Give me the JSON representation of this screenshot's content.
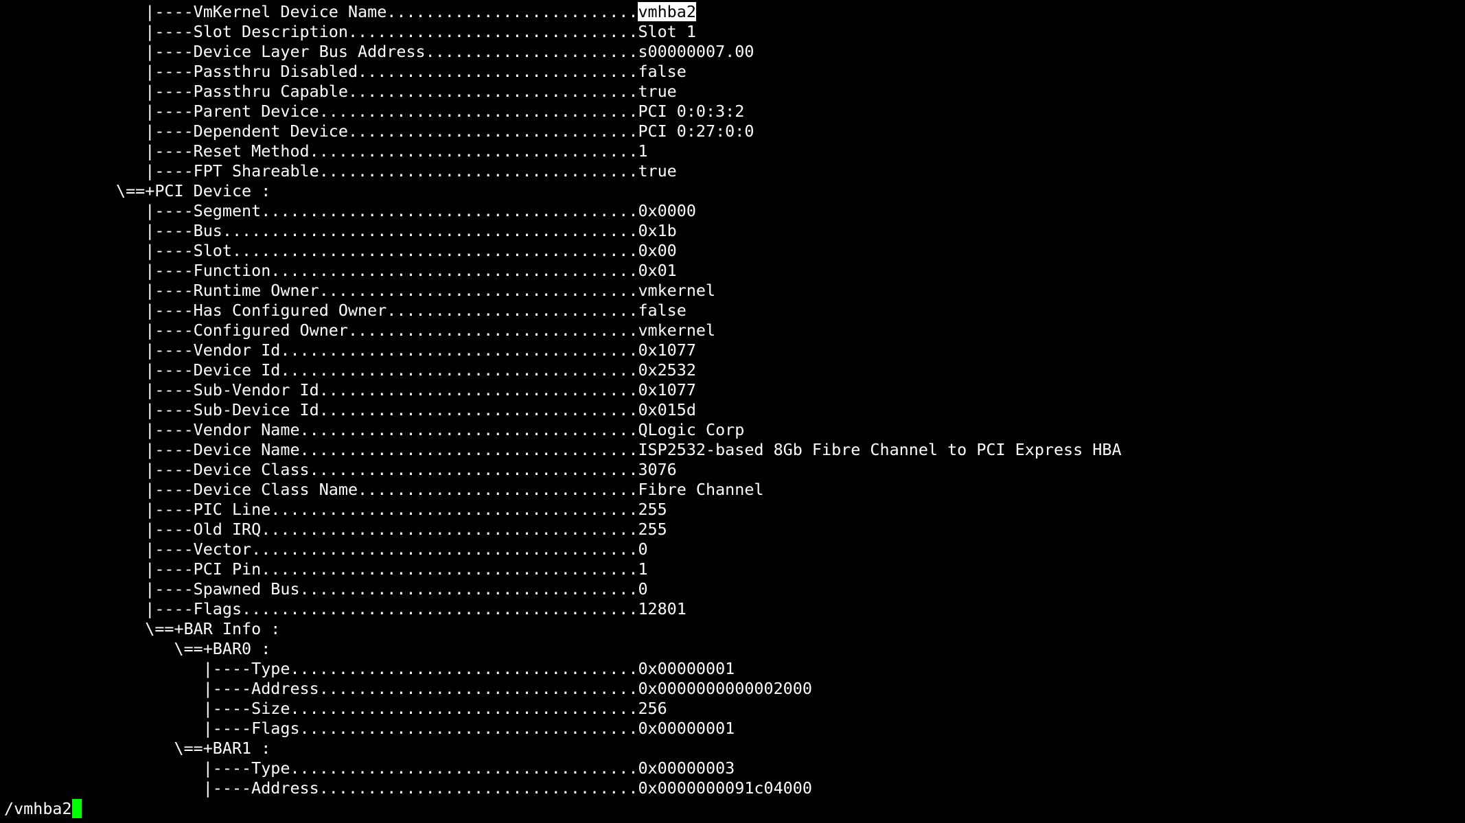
{
  "screen": {
    "highlight": {
      "color": "#ffffff"
    },
    "cursor_color": "#00ff00"
  },
  "lines": [
    {
      "text": "               |----VmKernel Device Name..........................",
      "value": "vmhba2",
      "highlight": true
    },
    {
      "text": "               |----Slot Description..............................",
      "value": "Slot 1"
    },
    {
      "text": "               |----Device Layer Bus Address......................",
      "value": "s00000007.00"
    },
    {
      "text": "               |----Passthru Disabled.............................",
      "value": "false"
    },
    {
      "text": "               |----Passthru Capable..............................",
      "value": "true"
    },
    {
      "text": "               |----Parent Device.................................",
      "value": "PCI 0:0:3:2"
    },
    {
      "text": "               |----Dependent Device..............................",
      "value": "PCI 0:27:0:0"
    },
    {
      "text": "               |----Reset Method..................................",
      "value": "1"
    },
    {
      "text": "               |----FPT Shareable.................................",
      "value": "true"
    },
    {
      "text": "            \\==+PCI Device :",
      "value": ""
    },
    {
      "text": "               |----Segment.......................................",
      "value": "0x0000"
    },
    {
      "text": "               |----Bus...........................................",
      "value": "0x1b"
    },
    {
      "text": "               |----Slot..........................................",
      "value": "0x00"
    },
    {
      "text": "               |----Function......................................",
      "value": "0x01"
    },
    {
      "text": "               |----Runtime Owner.................................",
      "value": "vmkernel"
    },
    {
      "text": "               |----Has Configured Owner..........................",
      "value": "false"
    },
    {
      "text": "               |----Configured Owner..............................",
      "value": "vmkernel"
    },
    {
      "text": "               |----Vendor Id.....................................",
      "value": "0x1077"
    },
    {
      "text": "               |----Device Id.....................................",
      "value": "0x2532"
    },
    {
      "text": "               |----Sub-Vendor Id.................................",
      "value": "0x1077"
    },
    {
      "text": "               |----Sub-Device Id.................................",
      "value": "0x015d"
    },
    {
      "text": "               |----Vendor Name...................................",
      "value": "QLogic Corp"
    },
    {
      "text": "               |----Device Name...................................",
      "value": "ISP2532-based 8Gb Fibre Channel to PCI Express HBA"
    },
    {
      "text": "               |----Device Class..................................",
      "value": "3076"
    },
    {
      "text": "               |----Device Class Name.............................",
      "value": "Fibre Channel"
    },
    {
      "text": "               |----PIC Line......................................",
      "value": "255"
    },
    {
      "text": "               |----Old IRQ.......................................",
      "value": "255"
    },
    {
      "text": "               |----Vector........................................",
      "value": "0"
    },
    {
      "text": "               |----PCI Pin.......................................",
      "value": "1"
    },
    {
      "text": "               |----Spawned Bus...................................",
      "value": "0"
    },
    {
      "text": "               |----Flags.........................................",
      "value": "12801"
    },
    {
      "text": "               \\==+BAR Info :",
      "value": ""
    },
    {
      "text": "                  \\==+BAR0 :",
      "value": ""
    },
    {
      "text": "                     |----Type....................................",
      "value": "0x00000001"
    },
    {
      "text": "                     |----Address.................................",
      "value": "0x0000000000002000"
    },
    {
      "text": "                     |----Size....................................",
      "value": "256"
    },
    {
      "text": "                     |----Flags...................................",
      "value": "0x00000001"
    },
    {
      "text": "                  \\==+BAR1 :",
      "value": ""
    },
    {
      "text": "                     |----Type....................................",
      "value": "0x00000003"
    },
    {
      "text": "                     |----Address.................................",
      "value": "0x0000000091c04000"
    }
  ],
  "prompt": {
    "text": "/vmhba2"
  }
}
